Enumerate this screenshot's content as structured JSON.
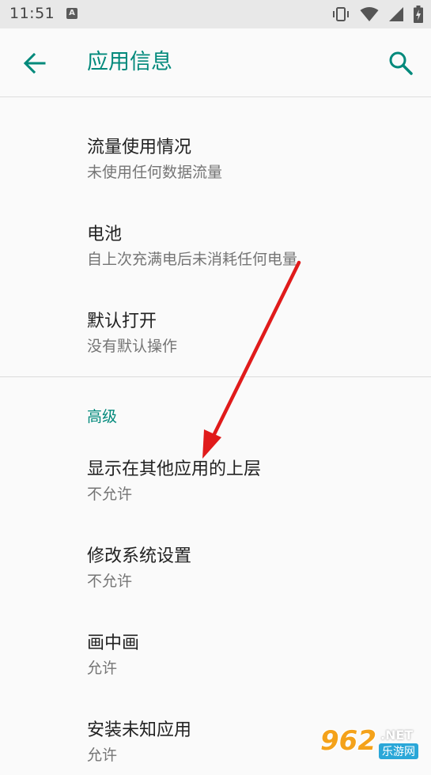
{
  "status_bar": {
    "time": "11:51",
    "notification_icon_letter": "A"
  },
  "app_bar": {
    "title": "应用信息",
    "accent_color": "#00897b"
  },
  "items": [
    {
      "title": "流量使用情况",
      "summary": "未使用任何数据流量"
    },
    {
      "title": "电池",
      "summary": "自上次充满电后未消耗任何电量"
    },
    {
      "title": "默认打开",
      "summary": "没有默认操作"
    }
  ],
  "advanced": {
    "header": "高级",
    "items": [
      {
        "title": "显示在其他应用的上层",
        "summary": "不允许"
      },
      {
        "title": "修改系统设置",
        "summary": "不允许"
      },
      {
        "title": "画中画",
        "summary": "允许"
      },
      {
        "title": "安装未知应用",
        "summary": "允许"
      }
    ]
  },
  "annotation": {
    "arrow_color": "#e01b1b"
  },
  "watermark": {
    "number": "962",
    "net": ".NET",
    "subtitle": "乐游网"
  }
}
